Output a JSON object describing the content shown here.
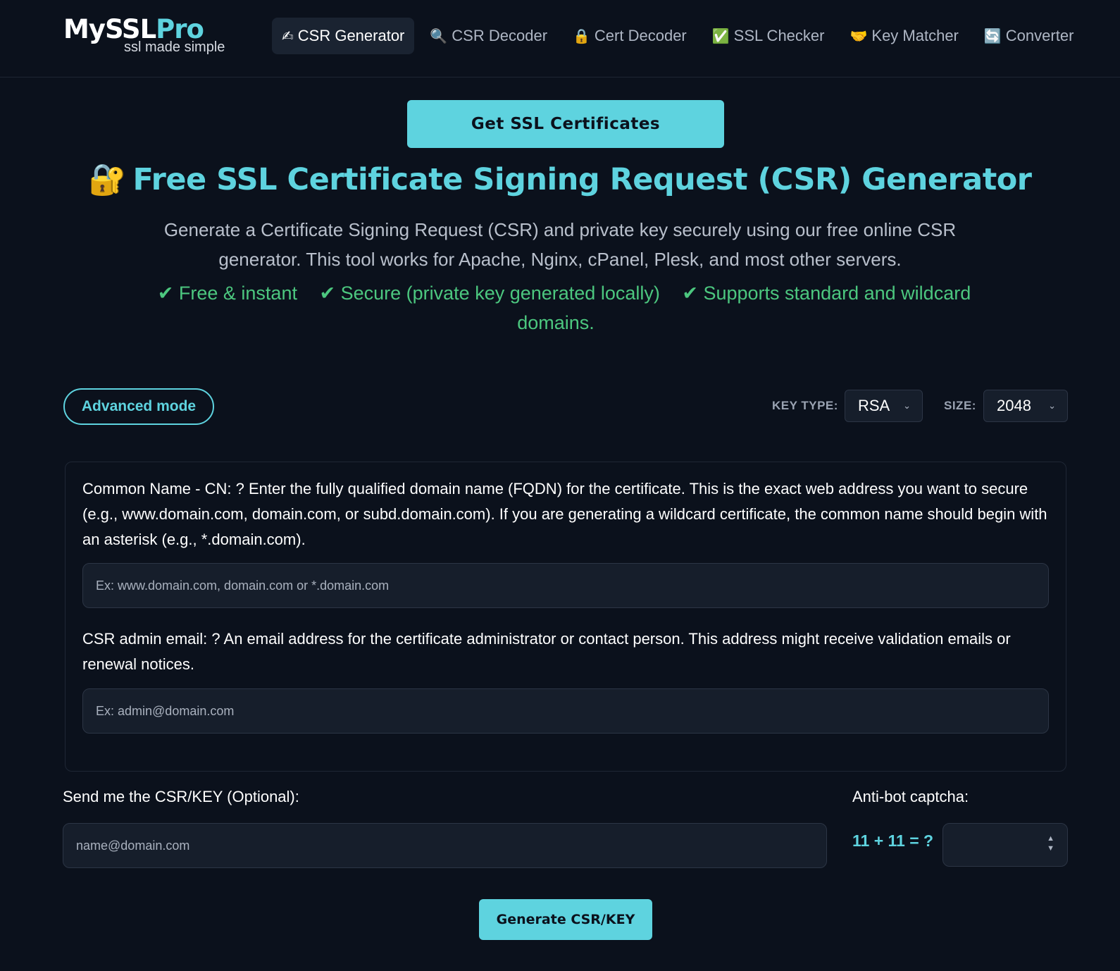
{
  "header": {
    "logo_a": "MySSL",
    "logo_b": "Pro",
    "tagline": "ssl made simple",
    "nav": [
      {
        "icon": "✍",
        "label": "CSR Generator"
      },
      {
        "icon": "🔍",
        "label": "CSR Decoder"
      },
      {
        "icon": "🔒",
        "label": "Cert Decoder"
      },
      {
        "icon": "✅",
        "label": "SSL Checker"
      },
      {
        "icon": "🤝",
        "label": "Key Matcher"
      },
      {
        "icon": "🔄",
        "label": "Converter"
      }
    ]
  },
  "hero": {
    "cta": "Get SSL Certificates",
    "title_icon": "🔐",
    "title": "Free SSL Certificate Signing Request (CSR) Generator",
    "subtitle": "Generate a Certificate Signing Request (CSR) and private key securely using our free online CSR generator. This tool works for Apache, Nginx, cPanel, Plesk, and most other servers.",
    "features": [
      "✔ Free & instant",
      "✔ Secure (private key generated locally)",
      "✔ Supports standard and wildcard domains."
    ]
  },
  "controls": {
    "advanced_mode": "Advanced mode",
    "key_type_label": "KEY TYPE:",
    "key_type_value": "RSA",
    "size_label": "SIZE:",
    "size_value": "2048"
  },
  "form": {
    "cn_label": "Common Name - CN: ? Enter the fully qualified domain name (FQDN) for the certificate. This is the exact web address you want to secure (e.g., www.domain.com, domain.com, or subd.domain.com). If you are generating a wildcard certificate, the common name should begin with an asterisk (e.g., *.domain.com).",
    "cn_placeholder": "Ex: www.domain.com, domain.com or *.domain.com",
    "email_label": "CSR admin email: ? An email address for the certificate administrator or contact person. This address might receive validation emails or renewal notices.",
    "email_placeholder": "Ex: admin@domain.com",
    "send_label": "Send me the CSR/KEY (Optional):",
    "send_placeholder": "name@domain.com",
    "captcha_label": "Anti-bot captcha:",
    "captcha_question": "11 + 11 = ?",
    "submit": "Generate CSR/KEY"
  }
}
